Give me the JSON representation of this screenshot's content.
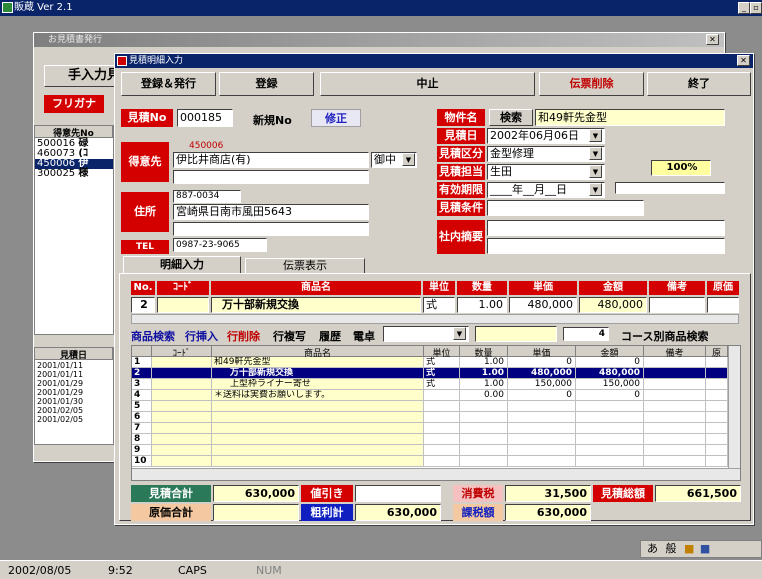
{
  "app": {
    "title": "販蔵 Ver 2.1"
  },
  "back_window": {
    "title": "お見積書発行",
    "heading": "手入力見",
    "furigana_label": "フリガナ",
    "customer_col": "得意先No",
    "customers": [
      {
        "no": "500016",
        "mark": "碌"
      },
      {
        "no": "460073",
        "mark": "(ｺ"
      },
      {
        "no": "450006",
        "mark": "伊"
      },
      {
        "no": "300025",
        "mark": "様"
      }
    ],
    "date_col": "見積日",
    "dates": [
      "2001/01/11",
      "2001/01/11",
      "2001/01/29",
      "2001/01/29",
      "2001/01/30",
      "2001/02/05",
      "2001/02/05"
    ]
  },
  "main_window": {
    "title": "見積明細入力",
    "toolbar": {
      "register_issue": "登録＆発行",
      "register": "登録",
      "middle": "中止",
      "delete": "伝票削除",
      "end": "終了"
    },
    "estimate_no_label": "見積No",
    "estimate_no": "000185",
    "new_no": "新規No",
    "edit": "修正",
    "customer_label": "得意先",
    "customer_code": "450006",
    "customer_name": "伊比井商店(有)",
    "honorific": "御中",
    "address_label": "住所",
    "postal": "887-0034",
    "address": "宮崎県日南市風田5643",
    "tel_label": "TEL",
    "tel": "0987-23-9065",
    "item_name_label": "物件名",
    "search_label": "検索",
    "item_name": "和49軒先金型",
    "date_label": "見積日",
    "date": "2002年06月06日",
    "category_label": "見積区分",
    "category": "金型修理",
    "staff_label": "見積担当",
    "staff": "生田",
    "percent": "100%",
    "valid_label": "有効期限",
    "valid": "____年__月__日",
    "conditions_label": "見積条件",
    "memo_label": "社内摘要",
    "tabs": [
      "明細入力",
      "伝票表示"
    ],
    "edit_row": {
      "no_label": "No.",
      "code_label": "ｺｰﾄﾞ",
      "name_label": "商品名",
      "unit_label": "単位",
      "qty_label": "数量",
      "price_label": "単価",
      "amount_label": "金額",
      "note_label": "備考",
      "cost_label": "原価",
      "no": "2",
      "name": "万十部新規交換",
      "unit": "式",
      "qty": "1.00",
      "price": "480,000",
      "amount": "480,000"
    },
    "actions": {
      "search": "商品検索",
      "insert": "行挿入",
      "delete": "行削除",
      "copy": "行複写",
      "history": "履歴",
      "calc": "電卓",
      "course_count": "4",
      "course_search": "コース別商品検索"
    },
    "grid": {
      "headers": [
        "",
        "ｺｰﾄﾞ",
        "商品名",
        "単位",
        "数量",
        "単価",
        "金額",
        "備考",
        "原"
      ],
      "rows": [
        {
          "no": "1",
          "name": "和49軒先金型",
          "unit": "式",
          "qty": "1.00",
          "price": "0",
          "amount": "0"
        },
        {
          "no": "2",
          "name": "万十部新規交換",
          "unit": "式",
          "qty": "1.00",
          "price": "480,000",
          "amount": "480,000"
        },
        {
          "no": "3",
          "name": "上型枠ライナー寄せ",
          "unit": "式",
          "qty": "1.00",
          "price": "150,000",
          "amount": "150,000"
        },
        {
          "no": "4",
          "name": "＊送料は実費お願いします。",
          "unit": "",
          "qty": "0.00",
          "price": "0",
          "amount": "0"
        },
        {
          "no": "5",
          "name": "",
          "unit": "",
          "qty": "",
          "price": "",
          "amount": ""
        },
        {
          "no": "6",
          "name": "",
          "unit": "",
          "qty": "",
          "price": "",
          "amount": ""
        },
        {
          "no": "7",
          "name": "",
          "unit": "",
          "qty": "",
          "price": "",
          "amount": ""
        },
        {
          "no": "8",
          "name": "",
          "unit": "",
          "qty": "",
          "price": "",
          "amount": ""
        },
        {
          "no": "9",
          "name": "",
          "unit": "",
          "qty": "",
          "price": "",
          "amount": ""
        },
        {
          "no": "10",
          "name": "",
          "unit": "",
          "qty": "",
          "price": "",
          "amount": ""
        }
      ]
    },
    "totals": {
      "est_total_label": "見積合計",
      "est_total": "630,000",
      "discount_label": "値引き",
      "discount": "",
      "tax_label": "消費税",
      "tax": "31,500",
      "grand_label": "見積総額",
      "grand": "661,500",
      "cost_total_label": "原価合計",
      "cost_total": "",
      "gross_label": "粗利計",
      "gross": "630,000",
      "taxable_label": "課税額",
      "taxable": "630,000"
    }
  },
  "status": {
    "date": "2002/08/05",
    "time": "9:52",
    "caps": "CAPS",
    "num": "NUM"
  },
  "ime": {
    "a": "あ",
    "han": "般"
  }
}
